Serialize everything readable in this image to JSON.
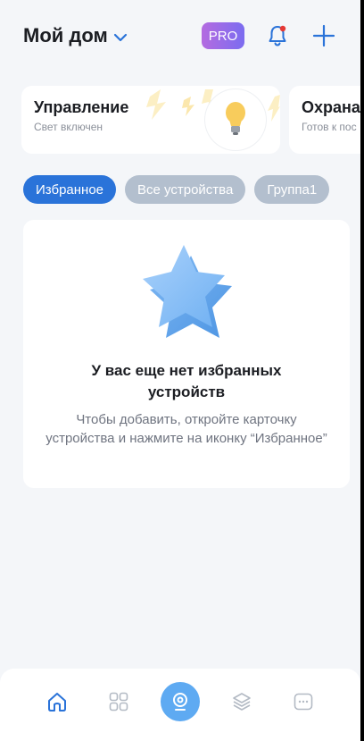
{
  "header": {
    "home_name": "Мой дом",
    "pro_label": "PRO"
  },
  "cards": {
    "control": {
      "title": "Управление",
      "subtitle": "Свет включен"
    },
    "guard": {
      "title": "Охрана",
      "subtitle": "Готов к пос"
    }
  },
  "tabs": [
    {
      "label": "Избранное",
      "active": true
    },
    {
      "label": "Все устройства",
      "active": false
    },
    {
      "label": "Группа1",
      "active": false
    }
  ],
  "empty_state": {
    "title": "У вас еще нет избранных устройств",
    "description": "Чтобы добавить, откройте карточку устройства и нажмите на иконку “Избранное”"
  },
  "bottom_nav": {
    "items": [
      "home-icon",
      "devices-grid-icon",
      "camera-icon",
      "layers-icon",
      "more-icon"
    ],
    "active_color": "#2a73d9",
    "center_color": "#5eaaf2"
  },
  "colors": {
    "accent": "#2a73d9",
    "tab_inactive": "#b3bfce",
    "background": "#f4f6f9"
  }
}
